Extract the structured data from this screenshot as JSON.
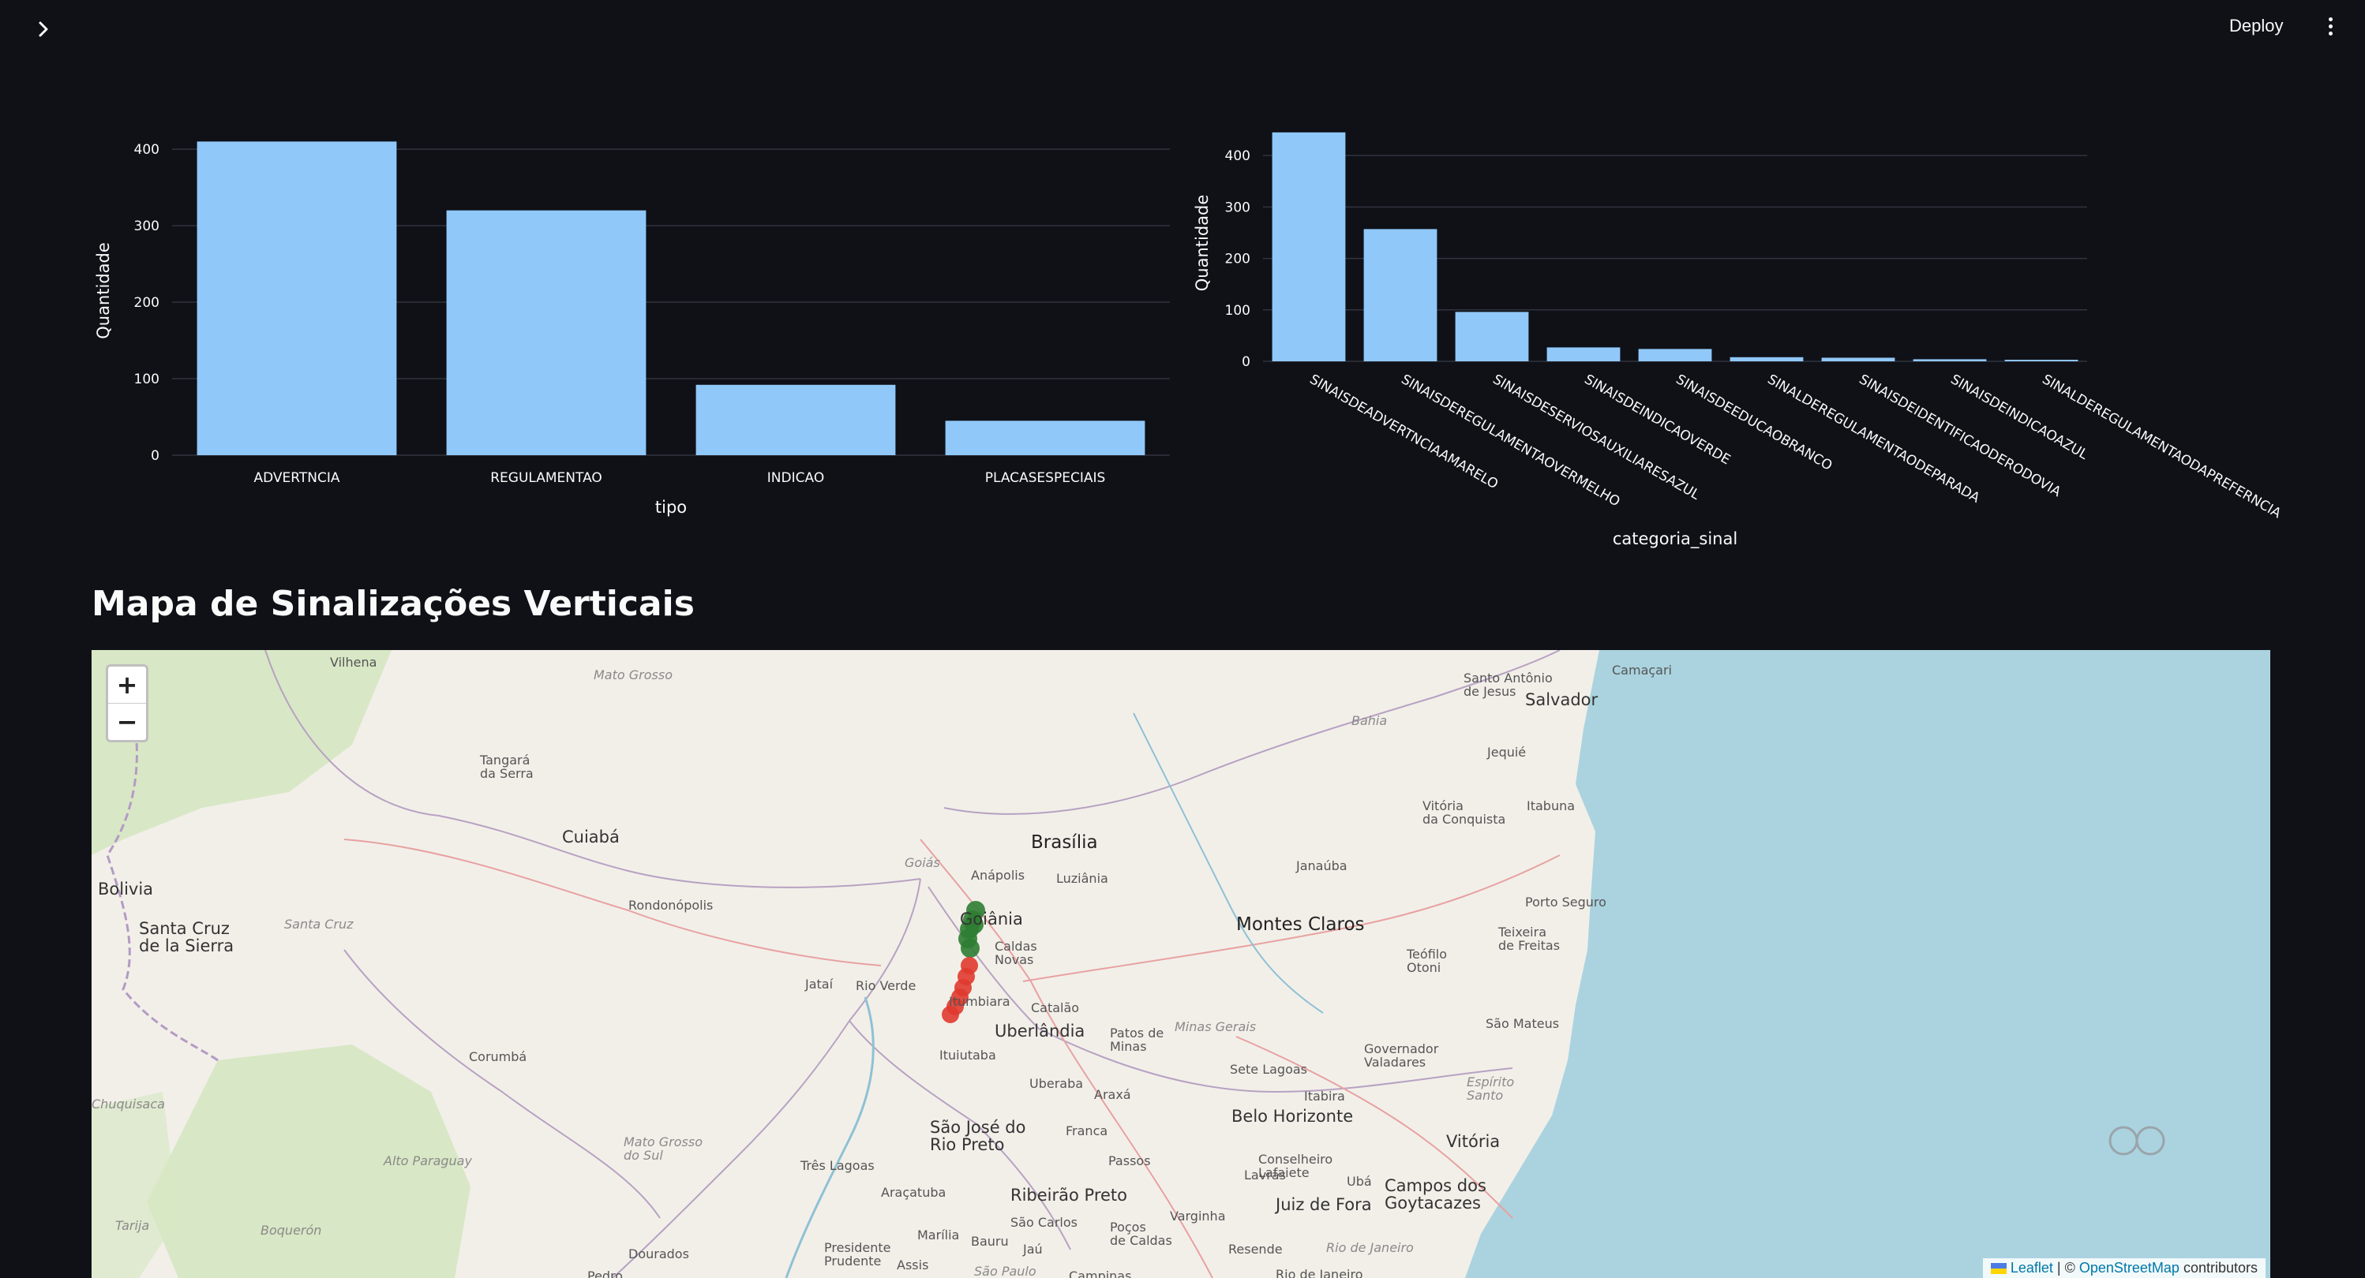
{
  "header": {
    "deploy_label": "Deploy",
    "sidebar_toggle_icon": "chevron-right-icon",
    "menu_icon": "kebab-menu-icon"
  },
  "colors": {
    "background": "#0f1117",
    "bar": "#90c8f9",
    "text": "#fafafa",
    "grid": "#31333f",
    "marker_green": "#2e7d32",
    "marker_red": "#e03a2f",
    "water": "#aad3df"
  },
  "chart_data": [
    {
      "type": "bar",
      "title": "",
      "xlabel": "tipo",
      "ylabel": "Quantidade",
      "categories": [
        "ADVERTNCIA",
        "REGULAMENTAO",
        "INDICAO",
        "PLACASESPECIAIS"
      ],
      "values": [
        410,
        320,
        92,
        45
      ],
      "yticks": [
        0,
        100,
        200,
        300,
        400
      ],
      "ylim": [
        0,
        430
      ],
      "grid": true,
      "x_tick_rotation": 0
    },
    {
      "type": "bar",
      "title": "",
      "xlabel": "categoria_sinal",
      "ylabel": "Quantidade",
      "categories": [
        "SINAISDEADVERTNCIAAMARELO",
        "SINAISDEREGULAMENTAOVERMELHO",
        "SINAISDESERVIOSAUXILIARESAZUL",
        "SINAISDEINDICAOVERDE",
        "SINAISDEEDUCAOBRANCO",
        "SINALDEREGULAMENTAODEPARADA",
        "SINAISDEIDENTIFICAODERODOVIA",
        "SINAISDEINDICAOAZUL",
        "SINALDEREGULAMENTAODAPREFERNCIA"
      ],
      "values": [
        445,
        257,
        96,
        27,
        24,
        8,
        7,
        4,
        3
      ],
      "yticks": [
        0,
        100,
        200,
        300,
        400
      ],
      "ylim": [
        0,
        460
      ],
      "grid": true,
      "x_tick_rotation": 30
    }
  ],
  "map": {
    "title": "Mapa de Sinalizações Verticais",
    "zoom_in": "+",
    "zoom_out": "−",
    "attribution": {
      "leaflet": "Leaflet",
      "separator": "| ©",
      "osm": "OpenStreetMap",
      "suffix": "contributors"
    },
    "places": [
      {
        "name": "Vilhena",
        "kind": "town"
      },
      {
        "name": "Mato Grosso",
        "kind": "region"
      },
      {
        "name": "Tangará da Serra",
        "kind": "town"
      },
      {
        "name": "Cuiabá",
        "kind": "city"
      },
      {
        "name": "Bolivia",
        "kind": "city"
      },
      {
        "name": "Santa Cruz",
        "kind": "region"
      },
      {
        "name": "Santa Cruz de la Sierra",
        "kind": "city"
      },
      {
        "name": "Rondonópolis",
        "kind": "town"
      },
      {
        "name": "Corumbá",
        "kind": "town"
      },
      {
        "name": "Alto Paraguay",
        "kind": "region"
      },
      {
        "name": "Mato Grosso do Sul",
        "kind": "region"
      },
      {
        "name": "Boquerón",
        "kind": "region"
      },
      {
        "name": "Tarija",
        "kind": "region"
      },
      {
        "name": "Chuquisaca",
        "kind": "region"
      },
      {
        "name": "Dourados",
        "kind": "town"
      },
      {
        "name": "Pedro",
        "kind": "town"
      },
      {
        "name": "Goiás",
        "kind": "region"
      },
      {
        "name": "Brasília",
        "kind": "city"
      },
      {
        "name": "Anápolis",
        "kind": "town"
      },
      {
        "name": "Luziânia",
        "kind": "town"
      },
      {
        "name": "Goiânia",
        "kind": "city"
      },
      {
        "name": "Caldas Novas",
        "kind": "town"
      },
      {
        "name": "Jataí",
        "kind": "town"
      },
      {
        "name": "Rio Verde",
        "kind": "town"
      },
      {
        "name": "Itumbiara",
        "kind": "town"
      },
      {
        "name": "Catalão",
        "kind": "town"
      },
      {
        "name": "Uberlândia",
        "kind": "city"
      },
      {
        "name": "Patos de Minas",
        "kind": "town"
      },
      {
        "name": "Minas Gerais",
        "kind": "region"
      },
      {
        "name": "Ituiutaba",
        "kind": "town"
      },
      {
        "name": "Uberaba",
        "kind": "town"
      },
      {
        "name": "Araxá",
        "kind": "town"
      },
      {
        "name": "São José do Rio Preto",
        "kind": "city"
      },
      {
        "name": "Franca",
        "kind": "town"
      },
      {
        "name": "Três Lagoas",
        "kind": "town"
      },
      {
        "name": "Araçatuba",
        "kind": "town"
      },
      {
        "name": "Ribeirão Preto",
        "kind": "city"
      },
      {
        "name": "Passos",
        "kind": "town"
      },
      {
        "name": "Marília",
        "kind": "town"
      },
      {
        "name": "Bauru",
        "kind": "town"
      },
      {
        "name": "São Carlos",
        "kind": "town"
      },
      {
        "name": "Poços de Caldas",
        "kind": "town"
      },
      {
        "name": "Presidente Prudente",
        "kind": "town"
      },
      {
        "name": "Assis",
        "kind": "town"
      },
      {
        "name": "Jaú",
        "kind": "town"
      },
      {
        "name": "São Paulo",
        "kind": "region"
      },
      {
        "name": "Campinas",
        "kind": "town"
      },
      {
        "name": "Varginha",
        "kind": "town"
      },
      {
        "name": "Lavras",
        "kind": "town"
      },
      {
        "name": "Conselheiro Lafaiete",
        "kind": "town"
      },
      {
        "name": "Ubá",
        "kind": "town"
      },
      {
        "name": "Juiz de Fora",
        "kind": "city"
      },
      {
        "name": "Campos dos Goytacazes",
        "kind": "city"
      },
      {
        "name": "Resende",
        "kind": "town"
      },
      {
        "name": "Rio de Janeiro",
        "kind": "region"
      },
      {
        "name": "Rio de Janeiro",
        "kind": "town"
      },
      {
        "name": "Belo Horizonte",
        "kind": "city"
      },
      {
        "name": "Itabira",
        "kind": "town"
      },
      {
        "name": "Sete Lagoas",
        "kind": "town"
      },
      {
        "name": "Montes Claros",
        "kind": "city"
      },
      {
        "name": "Janaúba",
        "kind": "town"
      },
      {
        "name": "Governador Valadares",
        "kind": "town"
      },
      {
        "name": "Teófilo Otoni",
        "kind": "town"
      },
      {
        "name": "Teixeira de Freitas",
        "kind": "town"
      },
      {
        "name": "Porto Seguro",
        "kind": "town"
      },
      {
        "name": "São Mateus",
        "kind": "town"
      },
      {
        "name": "Espírito Santo",
        "kind": "region"
      },
      {
        "name": "Vitória",
        "kind": "city"
      },
      {
        "name": "Vitória da Conquista",
        "kind": "town"
      },
      {
        "name": "Itabuna",
        "kind": "town"
      },
      {
        "name": "Jequié",
        "kind": "town"
      },
      {
        "name": "Bahia",
        "kind": "region"
      },
      {
        "name": "Santo Antônio de Jesus",
        "kind": "town"
      },
      {
        "name": "Salvador",
        "kind": "city"
      },
      {
        "name": "Camaçari",
        "kind": "town"
      }
    ]
  }
}
